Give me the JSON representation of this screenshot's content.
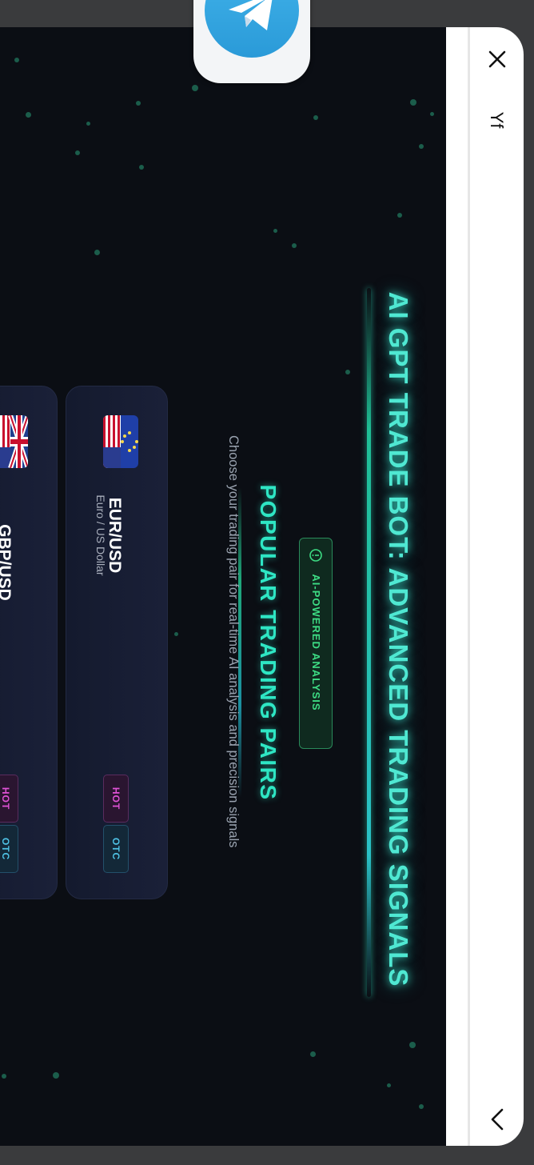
{
  "window": {
    "bot_name": "Yf",
    "close_label": "close",
    "back_label": "back"
  },
  "app": {
    "title": "AI GPT TRADE BOT: ADVANCED TRADING SIGNALS",
    "badge": "AI-POWERED ANALYSIS",
    "section_title": "POPULAR TRADING PAIRS",
    "description": "Choose your trading pair for real-time AI analysis and precision signals"
  },
  "pairs": [
    {
      "symbol": "EUR/USD",
      "name": "Euro / US Dollar",
      "tags": [
        "HOT",
        "OTC"
      ]
    },
    {
      "symbol": "GBP/USD",
      "name": "",
      "tags": [
        "HOT",
        "OTC"
      ]
    }
  ],
  "colors": {
    "accent": "#2ee6c4",
    "hot": "#e052d6",
    "otc": "#4fc3e6",
    "badge": "#3ddc84"
  }
}
